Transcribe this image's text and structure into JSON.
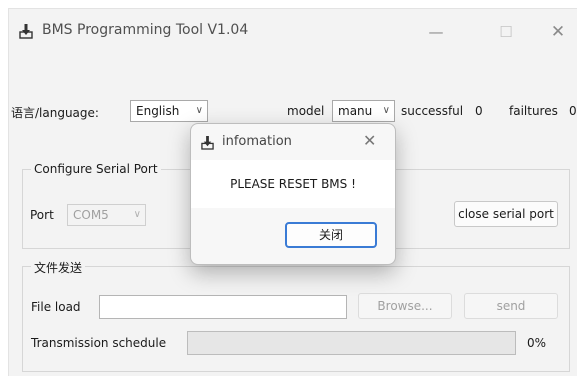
{
  "window": {
    "title": "BMS Programming Tool V1.04",
    "icons": {
      "app": "download-tray-icon",
      "minimize": "minimize-icon",
      "maximize": "maximize-icon",
      "close": "close-icon"
    },
    "min_glyph": "—",
    "max_glyph": "☐",
    "close_glyph": "✕"
  },
  "top_row": {
    "language_label": "语言/language:",
    "language_value": "English",
    "model_label": "model",
    "model_value": "manu",
    "successful_label": "successful",
    "successful_count": "0",
    "failures_label": "failtures",
    "failures_count": "0"
  },
  "serial_group": {
    "title": "Configure Serial Port",
    "port_label": "Port",
    "port_value": "COM5",
    "close_button": "close serial port"
  },
  "file_group": {
    "title": "文件发送",
    "file_load_label": "File load",
    "file_path": "",
    "browse_button": "Browse...",
    "send_button": "send",
    "schedule_label": "Transmission schedule",
    "progress_fraction": 0,
    "progress_text": "0%"
  },
  "dialog": {
    "title": "infomation",
    "message": "PLEASE RESET BMS !",
    "ok_button": "关闭",
    "close_glyph": "✕"
  },
  "colors": {
    "accent": "#3a7bd5",
    "progress": "#06b025",
    "window_bg": "#f3f3f3"
  }
}
